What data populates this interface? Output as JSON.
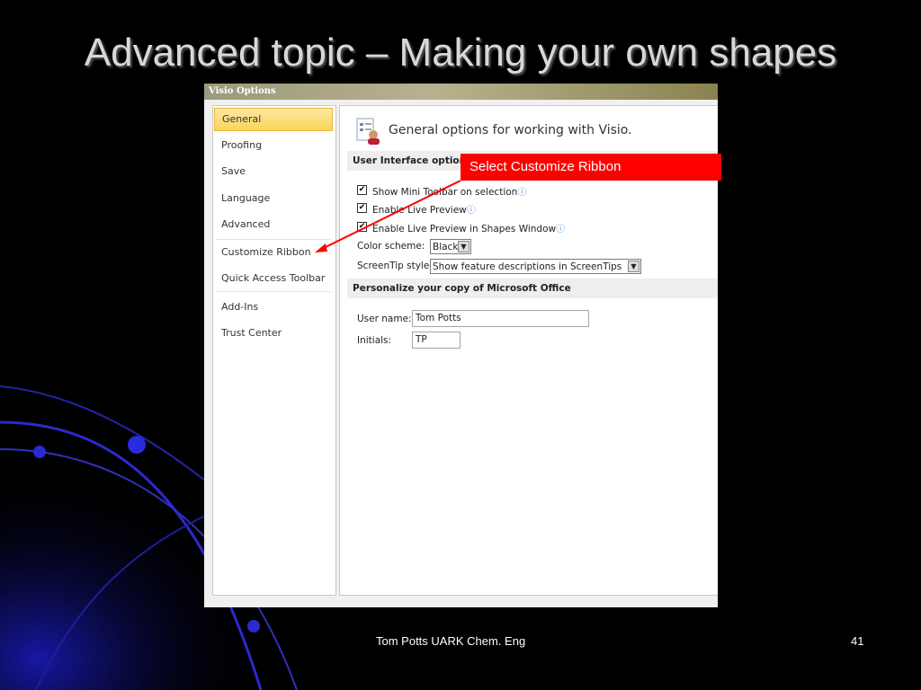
{
  "slide": {
    "title": "Advanced topic – Making your own shapes",
    "footer_text": "Tom Potts  UARK Chem. Eng",
    "page_number": "41",
    "callout": "Select Customize Ribbon"
  },
  "dialog": {
    "title": "Visio Options",
    "nav": [
      "General",
      "Proofing",
      "Save",
      "Language",
      "Advanced",
      "Customize Ribbon",
      "Quick Access Toolbar",
      "Add-Ins",
      "Trust Center"
    ],
    "selected_nav": "General",
    "header": "General options for working with Visio.",
    "section_ui": "User Interface options",
    "options": {
      "mini_toolbar": "Show Mini Toolbar on selection",
      "live_preview": "Enable Live Preview",
      "live_preview_shapes": "Enable Live Preview in Shapes Window"
    },
    "color_scheme_label": "Color scheme:",
    "color_scheme_value": "Black",
    "screentip_label": "ScreenTip style:",
    "screentip_value": "Show feature descriptions in ScreenTips",
    "section_personalize": "Personalize your copy of Microsoft Office",
    "user_name_label": "User name:",
    "user_name_value": "Tom Potts",
    "initials_label": "Initials:",
    "initials_value": "TP"
  },
  "colors": {
    "background": "#000000",
    "callout": "#ff0000",
    "selected_nav": "#fbd35a",
    "arrow": "#ff0000"
  }
}
